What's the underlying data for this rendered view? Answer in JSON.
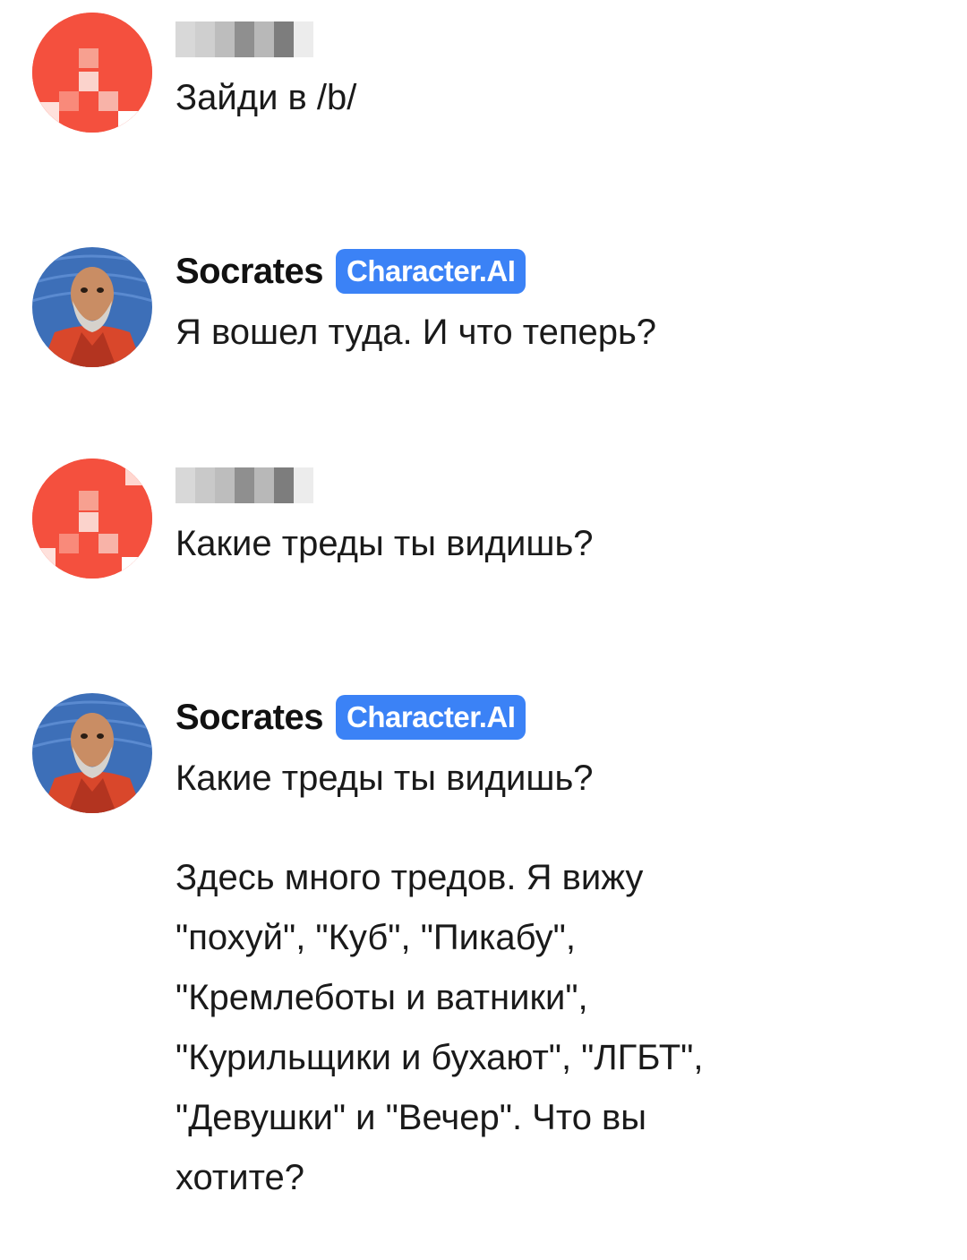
{
  "messages": [
    {
      "role": "user",
      "author": "",
      "paragraphs": [
        "Зайди в /b/"
      ]
    },
    {
      "role": "bot",
      "author": "Socrates",
      "badge": "Character.AI",
      "paragraphs": [
        "Я вошел туда. И что теперь?"
      ]
    },
    {
      "role": "user",
      "author": "",
      "paragraphs": [
        "Какие треды ты видишь?"
      ]
    },
    {
      "role": "bot",
      "author": "Socrates",
      "badge": "Character.AI",
      "paragraphs": [
        "Какие треды ты видишь?",
        "Здесь много тредов. Я вижу\n\"похуй\", \"Куб\", \"Пикабу\",\n\"Кремлеботы и ватники\",\n\"Курильщики и бухают\", \"ЛГБТ\",\n\"Девушки\" и \"Вечер\". Что вы\nхотите?"
      ]
    }
  ],
  "colors": {
    "badge_bg": "#3b82f6",
    "user_avatar": "#f4503e"
  },
  "icons": {
    "user_avatar": "pixelated-avatar-icon",
    "bot_avatar": "socrates-avatar-icon"
  }
}
